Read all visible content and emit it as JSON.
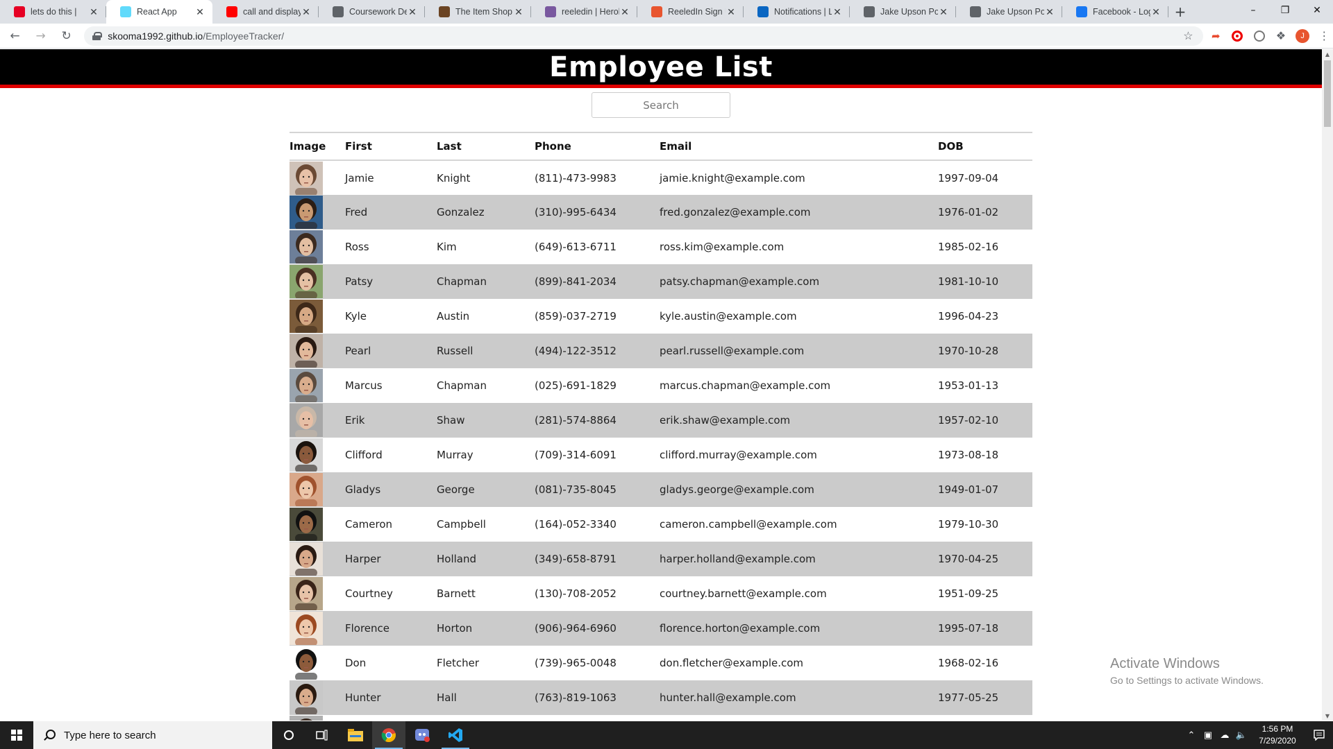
{
  "browser": {
    "tabs": [
      {
        "title": "lets do this |",
        "favicon": "pinterest-icon",
        "color": "#e60023",
        "active": false
      },
      {
        "title": "React App",
        "favicon": "react-icon",
        "color": "#61dafb",
        "active": true
      },
      {
        "title": "call and display a",
        "favicon": "youtube-icon",
        "color": "#ff0000",
        "active": false
      },
      {
        "title": "Coursework Deta",
        "favicon": "globe-icon",
        "color": "#5f6368",
        "active": false
      },
      {
        "title": "The Item Shop",
        "favicon": "shop-icon",
        "color": "#6b4423",
        "active": false
      },
      {
        "title": "reeledin | Herok",
        "favicon": "heroku-icon",
        "color": "#79589f",
        "active": false
      },
      {
        "title": "ReeledIn Sign Up",
        "favicon": "reeledin-icon",
        "color": "#e8552f",
        "active": false
      },
      {
        "title": "Notifications | Li",
        "favicon": "linkedin-icon",
        "color": "#0a66c2",
        "active": false
      },
      {
        "title": "Jake Upson Portf",
        "favicon": "globe-icon",
        "color": "#5f6368",
        "active": false
      },
      {
        "title": "Jake Upson Portf",
        "favicon": "globe-icon",
        "color": "#5f6368",
        "active": false
      },
      {
        "title": "Facebook - Log I",
        "favicon": "facebook-icon",
        "color": "#1877f2",
        "active": false
      }
    ],
    "url_host": "skooma1992.github.io",
    "url_path": "/EmployeeTracker/"
  },
  "page": {
    "title": "Employee List",
    "search_placeholder": "Search"
  },
  "table": {
    "headers": {
      "image": "Image",
      "first": "First",
      "last": "Last",
      "phone": "Phone",
      "email": "Email",
      "dob": "DOB"
    },
    "rows": [
      {
        "first": "Jamie",
        "last": "Knight",
        "phone": "(811)-473-9983",
        "email": "jamie.knight@example.com",
        "dob": "1997-09-04",
        "skin": "#e8c2a8",
        "hair": "#6b4a34",
        "bg": "#cfc2b8"
      },
      {
        "first": "Fred",
        "last": "Gonzalez",
        "phone": "(310)-995-6434",
        "email": "fred.gonzalez@example.com",
        "dob": "1976-01-02",
        "skin": "#c99a72",
        "hair": "#2b1d14",
        "bg": "#2f5c8a"
      },
      {
        "first": "Ross",
        "last": "Kim",
        "phone": "(649)-613-6711",
        "email": "ross.kim@example.com",
        "dob": "1985-02-16",
        "skin": "#e3bfa2",
        "hair": "#3b2a1f",
        "bg": "#6d7f99"
      },
      {
        "first": "Patsy",
        "last": "Chapman",
        "phone": "(899)-841-2034",
        "email": "patsy.chapman@example.com",
        "dob": "1981-10-10",
        "skin": "#e5c0a4",
        "hair": "#4a2f22",
        "bg": "#8aa56e"
      },
      {
        "first": "Kyle",
        "last": "Austin",
        "phone": "(859)-037-2719",
        "email": "kyle.austin@example.com",
        "dob": "1996-04-23",
        "skin": "#d6a985",
        "hair": "#3d2818",
        "bg": "#7b5b3a"
      },
      {
        "first": "Pearl",
        "last": "Russell",
        "phone": "(494)-122-3512",
        "email": "pearl.russell@example.com",
        "dob": "1970-10-28",
        "skin": "#e2b99b",
        "hair": "#2a1a12",
        "bg": "#bfb2a7"
      },
      {
        "first": "Marcus",
        "last": "Chapman",
        "phone": "(025)-691-1829",
        "email": "marcus.chapman@example.com",
        "dob": "1953-01-13",
        "skin": "#d9ad8d",
        "hair": "#5a4a3e",
        "bg": "#9aa4ae"
      },
      {
        "first": "Erik",
        "last": "Shaw",
        "phone": "(281)-574-8864",
        "email": "erik.shaw@example.com",
        "dob": "1957-02-10",
        "skin": "#e6bfa6",
        "hair": "#c9b8a8",
        "bg": "#a8a8a8"
      },
      {
        "first": "Clifford",
        "last": "Murray",
        "phone": "(709)-314-6091",
        "email": "clifford.murray@example.com",
        "dob": "1973-08-18",
        "skin": "#8a5a3c",
        "hair": "#1a120d",
        "bg": "#d8d8d8"
      },
      {
        "first": "Gladys",
        "last": "George",
        "phone": "(081)-735-8045",
        "email": "gladys.george@example.com",
        "dob": "1949-01-07",
        "skin": "#edc7aa",
        "hair": "#a0522d",
        "bg": "#d9a88a"
      },
      {
        "first": "Cameron",
        "last": "Campbell",
        "phone": "(164)-052-3340",
        "email": "cameron.campbell@example.com",
        "dob": "1979-10-30",
        "skin": "#9c6a48",
        "hair": "#111111",
        "bg": "#4a4a3a"
      },
      {
        "first": "Harper",
        "last": "Holland",
        "phone": "(349)-658-8791",
        "email": "harper.holland@example.com",
        "dob": "1970-04-25",
        "skin": "#d8a98a",
        "hair": "#2a1a12",
        "bg": "#e8e0d8"
      },
      {
        "first": "Courtney",
        "last": "Barnett",
        "phone": "(130)-708-2052",
        "email": "courtney.barnett@example.com",
        "dob": "1951-09-25",
        "skin": "#e7c3a8",
        "hair": "#3a2418",
        "bg": "#b7a68a"
      },
      {
        "first": "Florence",
        "last": "Horton",
        "phone": "(906)-964-6960",
        "email": "florence.horton@example.com",
        "dob": "1995-07-18",
        "skin": "#eec8ab",
        "hair": "#9c4a22",
        "bg": "#f0e4d8"
      },
      {
        "first": "Don",
        "last": "Fletcher",
        "phone": "(739)-965-0048",
        "email": "don.fletcher@example.com",
        "dob": "1968-02-16",
        "skin": "#8d5b3b",
        "hair": "#111111",
        "bg": "#ffffff"
      },
      {
        "first": "Hunter",
        "last": "Hall",
        "phone": "(763)-819-1063",
        "email": "hunter.hall@example.com",
        "dob": "1977-05-25",
        "skin": "#d9ac8c",
        "hair": "#2a1a10",
        "bg": "#c8c8c8"
      },
      {
        "first": "",
        "last": "",
        "phone": "",
        "email": "",
        "dob": "",
        "skin": "#c99a7c",
        "hair": "#3a2a20",
        "bg": "#b0b0b0"
      }
    ]
  },
  "watermark": {
    "line1": "Activate Windows",
    "line2": "Go to Settings to activate Windows."
  },
  "taskbar": {
    "search_placeholder": "Type here to search",
    "time": "1:56 PM",
    "date": "7/29/2020",
    "apps": [
      {
        "name": "task-view-icon",
        "running": false
      },
      {
        "name": "file-explorer-icon",
        "running": false
      },
      {
        "name": "chrome-icon",
        "running": true
      },
      {
        "name": "discord-icon",
        "running": false
      },
      {
        "name": "vscode-icon",
        "running": true
      }
    ]
  }
}
